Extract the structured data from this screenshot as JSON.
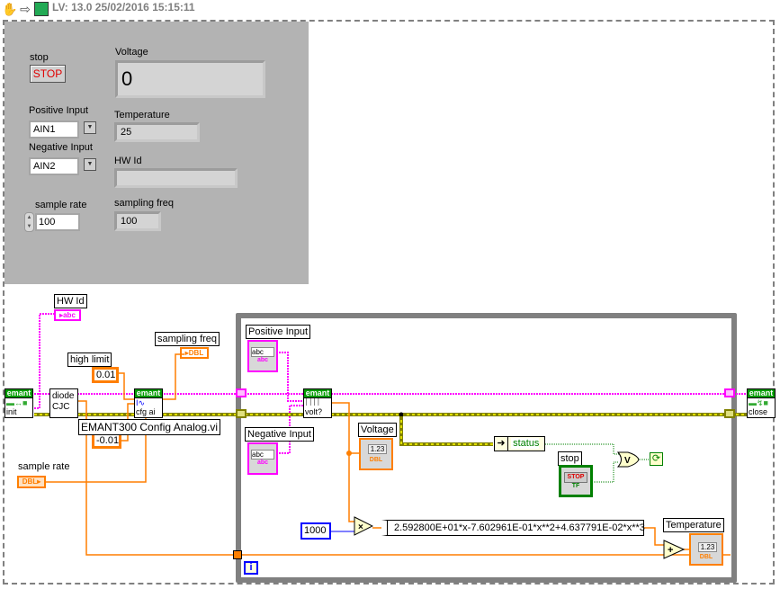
{
  "toolbar": {
    "icons": [
      "hand-tool-icon",
      "arrow-forward-icon",
      "vi-icon"
    ],
    "version_text": "LV: 13.0 25/02/2016 15:15:11"
  },
  "front_panel": {
    "stop": {
      "label": "stop",
      "button_text": "STOP"
    },
    "voltage": {
      "label": "Voltage",
      "value": "0"
    },
    "positive_input": {
      "label": "Positive Input",
      "value": "AIN1"
    },
    "negative_input": {
      "label": "Negative Input",
      "value": "AIN2"
    },
    "temperature": {
      "label": "Temperature",
      "value": "25"
    },
    "hw_id": {
      "label": "HW Id",
      "value": ""
    },
    "sample_rate": {
      "label": "sample rate",
      "value": "100"
    },
    "sampling_freq": {
      "label": "sampling freq",
      "value": "100"
    }
  },
  "block_diagram": {
    "hw_id_indicator": {
      "label": "HW Id",
      "type": "abc"
    },
    "sampling_freq_indicator": {
      "label": "sampling freq",
      "type": "DBL"
    },
    "high_limit": {
      "label": "high limit",
      "value": "0.01"
    },
    "low_limit": {
      "value": "-0.01"
    },
    "sample_rate_control": {
      "label": "sample rate",
      "type": "DBL"
    },
    "subvi_init": {
      "brand": "emant",
      "caption": "init"
    },
    "subvi_diode": {
      "line1": "diode",
      "line2": "CJC"
    },
    "subvi_cfg": {
      "brand": "emant",
      "caption": "cfg ai",
      "tooltip": "EMANT300 Config Analog.vi"
    },
    "subvi_volt": {
      "brand": "emant",
      "caption": "volt?"
    },
    "subvi_close": {
      "brand": "emant",
      "caption": "close"
    },
    "positive_input_control": {
      "label": "Positive Input",
      "ring": "abc",
      "type": "abc"
    },
    "negative_input_control": {
      "label": "Negative Input",
      "ring": "abc",
      "type": "abc"
    },
    "voltage_indicator": {
      "label": "Voltage",
      "display": "1.23",
      "type": "DBL"
    },
    "status_unbundle": {
      "label": "status"
    },
    "stop_control": {
      "label": "stop",
      "button_text": "STOP",
      "type": "TF"
    },
    "or_gate": {
      "symbol": "V"
    },
    "multiply_constant": {
      "value": "1000"
    },
    "multiply": {
      "symbol": "×"
    },
    "add": {
      "symbol": "+"
    },
    "formula_node": {
      "expression": "2.592800E+01*x-7.602961E-01*x**2+4.637791E-02*x**3"
    },
    "temperature_indicator": {
      "label": "Temperature",
      "display": "1.23",
      "type": "DBL"
    },
    "iteration_terminal": {
      "symbol": "i"
    }
  },
  "colors": {
    "string_wire": "#ff00ff",
    "double_wire": "#ff7f00",
    "error_wire": "#808000",
    "boolean_wire": "#008000",
    "integer_wire": "#0000ff",
    "subvi_header": "#009b00",
    "front_panel_bg": "#b3b3b3",
    "loop_border": "#808080"
  }
}
